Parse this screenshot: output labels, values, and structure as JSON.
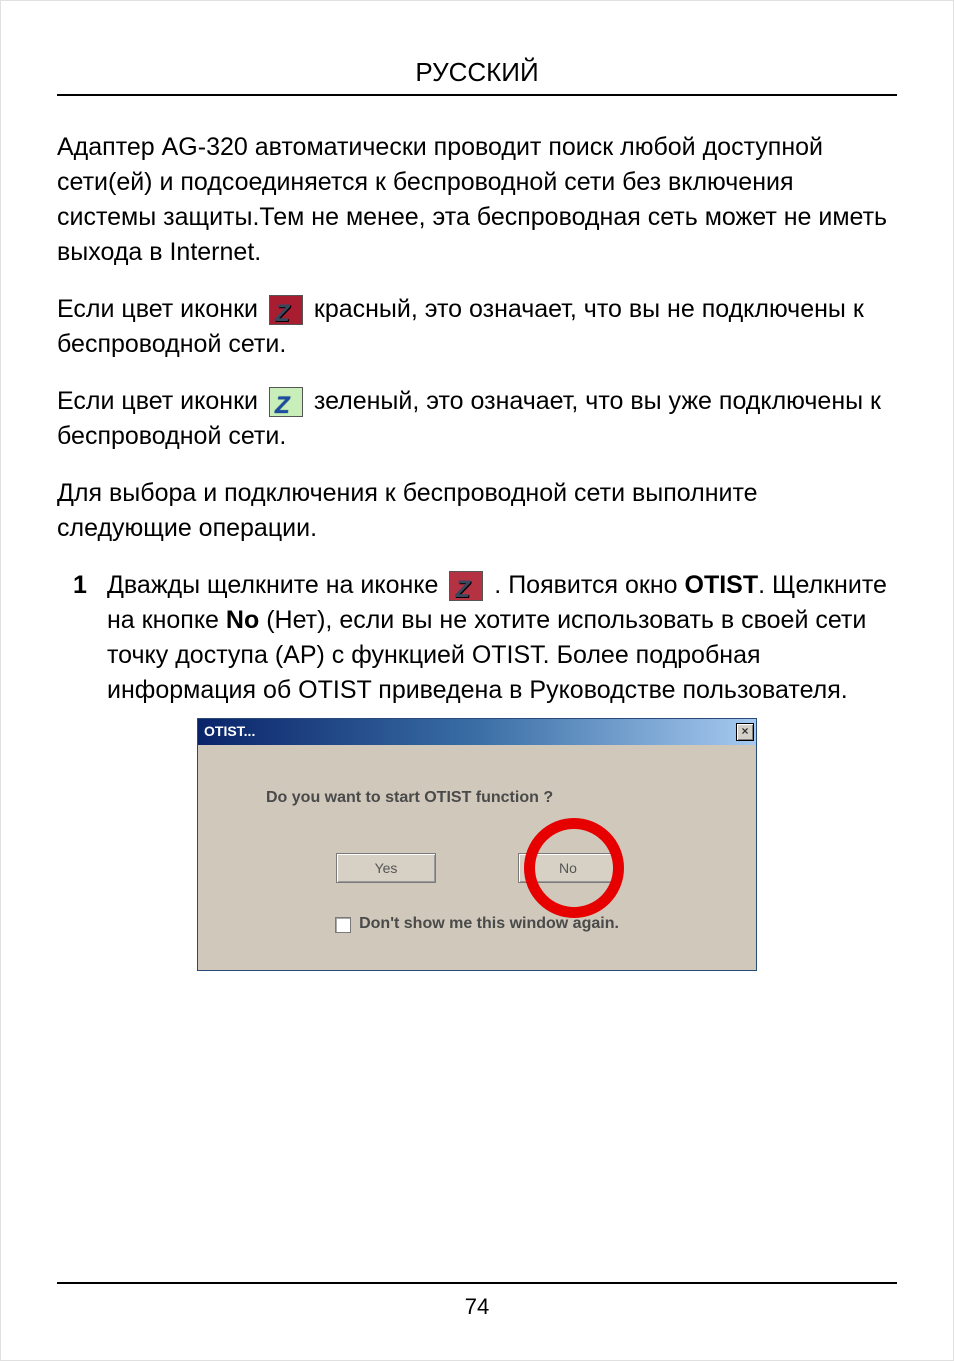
{
  "header": "РУССКИЙ",
  "page_number": "74",
  "para1": "Адаптер AG-320 автоматически проводит поиск любой доступной сети(ей) и подсоединяется к беспроводной сети без включения системы защиты.Тем не менее, эта беспроводная сеть может не иметь выхода в Internet.",
  "icon_line_red": {
    "before": "Если цвет иконки ",
    "after": " красный, это означает, что вы не подключены к беспроводной сети."
  },
  "icon_line_green": {
    "before": "Если цвет иконки ",
    "after": " зеленый, это означает, что вы уже подключены к беспроводной сети."
  },
  "para_instr": "Для выбора и подключения к беспроводной сети выполните следующие операции.",
  "step1": {
    "num": "1",
    "t1": "Дважды щелкните на иконке ",
    "t2": " . Появится окно ",
    "bold1": "OTIST",
    "t3": ". Щелкните на кнопке ",
    "bold2": "No",
    "t4": " (Нет), если вы не хотите использовать в своей сети точку доступа (AP) с функцией OTIST. Более подробная информация об OTIST приведена в Руководстве пользователя."
  },
  "dialog": {
    "title": "OTIST...",
    "close_glyph": "×",
    "question": "Do you want to start OTIST function ?",
    "yes_label": "Yes",
    "no_label": "No",
    "checkbox_label": "Don't show me this window again."
  },
  "icons": {
    "z": "Z"
  }
}
